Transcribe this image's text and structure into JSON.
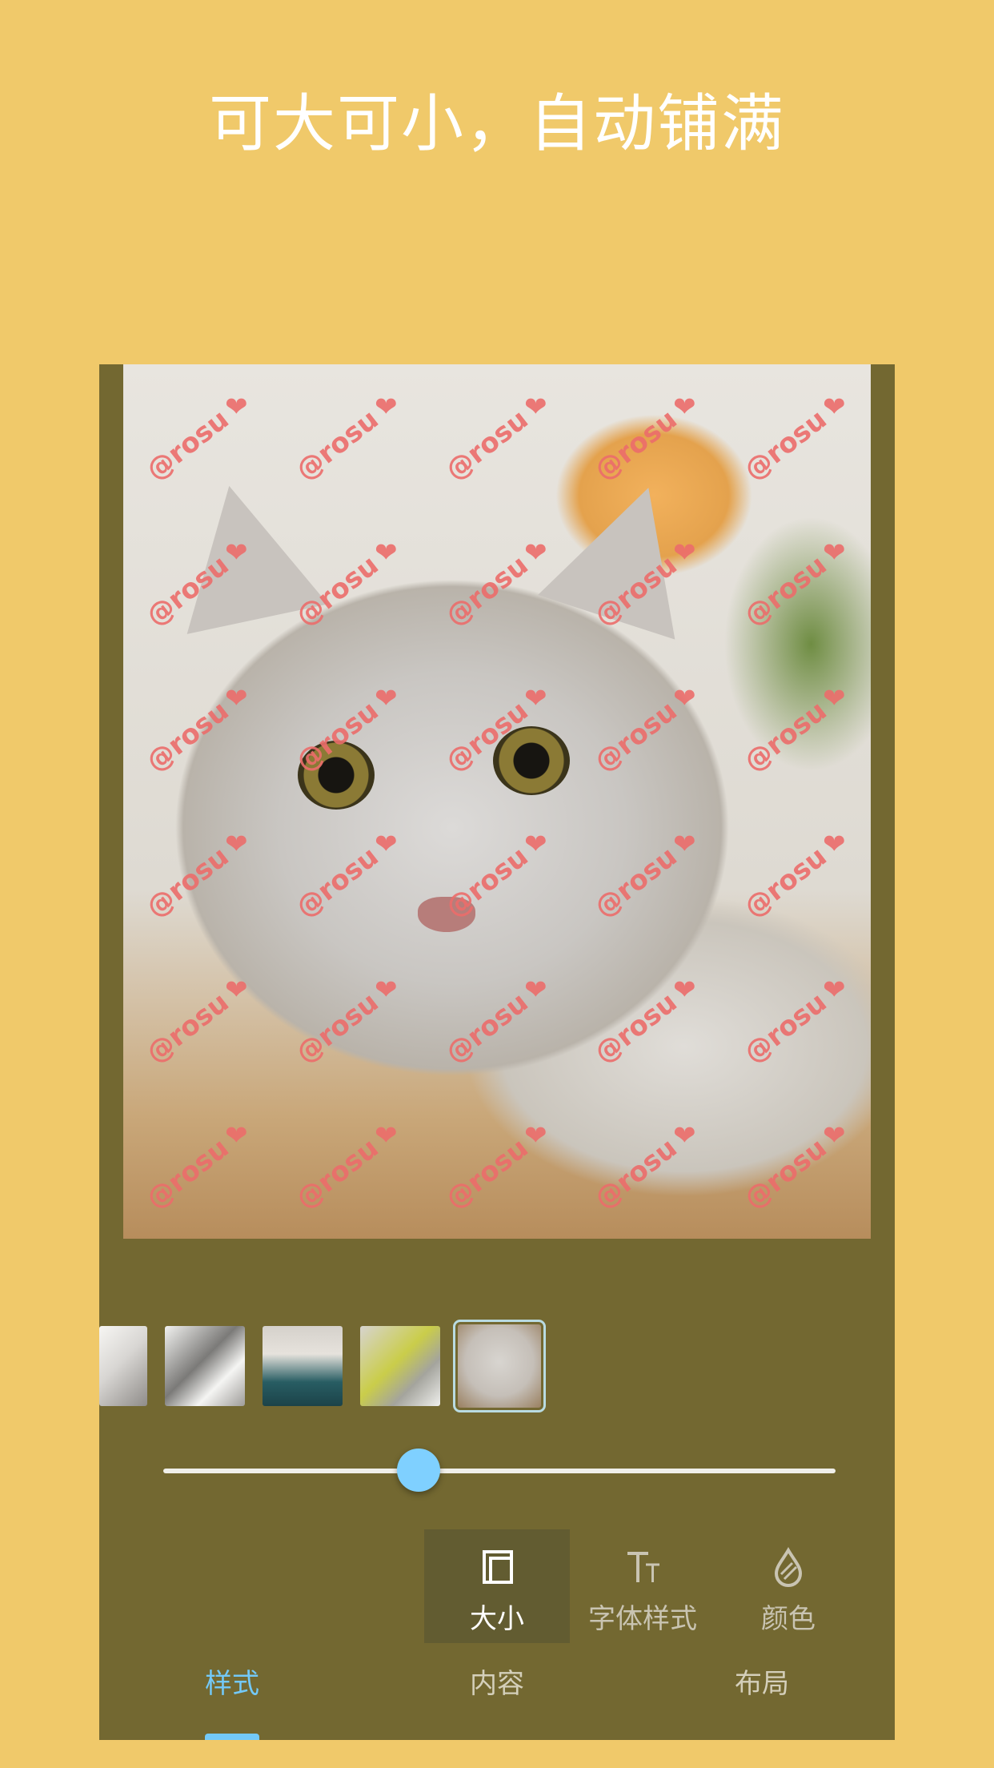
{
  "headline": "可大可小，自动铺满",
  "photo": {
    "watermark": "@rosu",
    "watermark_icon": "heart-icon"
  },
  "thumbnails": [
    {
      "name": "thumbnail-1",
      "selected": false
    },
    {
      "name": "thumbnail-2",
      "selected": false
    },
    {
      "name": "thumbnail-3",
      "selected": false
    },
    {
      "name": "thumbnail-4",
      "selected": false
    },
    {
      "name": "thumbnail-5",
      "selected": true
    }
  ],
  "slider": {
    "value": 0.35
  },
  "tools": {
    "size": {
      "label": "大小",
      "icon": "crop-square-icon",
      "active": true
    },
    "font_style": {
      "label": "字体样式",
      "icon": "text-style-icon",
      "active": false
    },
    "color": {
      "label": "颜色",
      "icon": "water-drop-icon",
      "active": false
    }
  },
  "tabs": {
    "style": {
      "label": "样式",
      "active": true
    },
    "content": {
      "label": "内容",
      "active": false
    },
    "layout": {
      "label": "布局",
      "active": false
    }
  },
  "colors": {
    "background": "#F0C96A",
    "panel": "#736831",
    "accent": "#73C9F8",
    "watermark": "#EC6D6B"
  }
}
